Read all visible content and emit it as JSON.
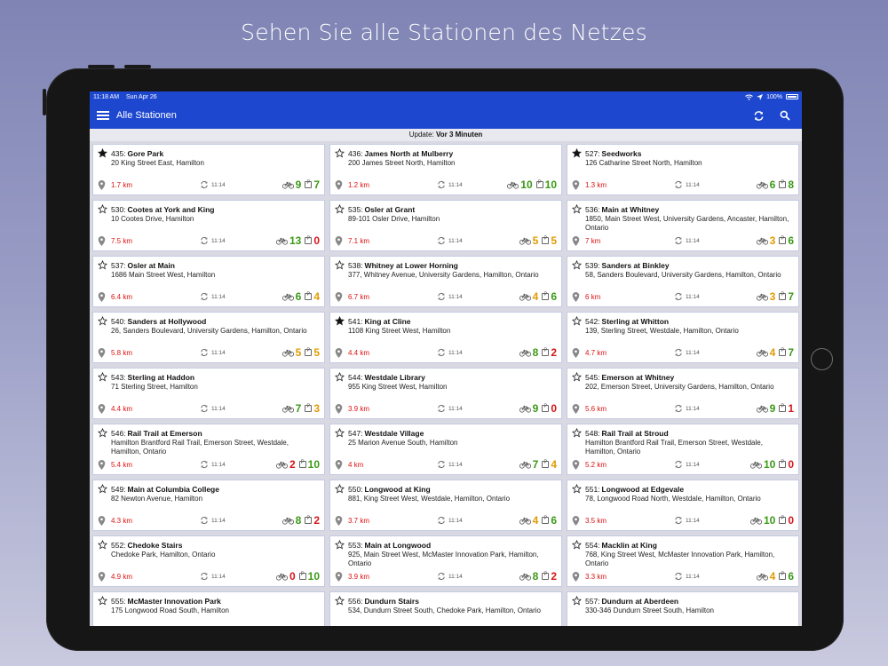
{
  "headline": "Sehen Sie alle Stationen des Netzes",
  "status_bar": {
    "time": "11:18 AM",
    "date": "Sun Apr 26",
    "battery": "100%"
  },
  "app_bar": {
    "title": "Alle Stationen",
    "menu_icon": "hamburger-menu-icon",
    "refresh_icon": "refresh-icon",
    "search_icon": "search-icon"
  },
  "update": {
    "label": "Update:",
    "value": "Vor 3 Minuten"
  },
  "colors": {
    "app_bar": "#1d47cf",
    "distance": "#dd1111",
    "good": "#3a9a16",
    "medium": "#e19a00",
    "bad": "#d6151a"
  },
  "stations": [
    {
      "id": "435:",
      "name": "Gore Park",
      "address": "20 King Street East, Hamilton",
      "distance": "1.7 km",
      "updated": "11:14",
      "bikes": "9",
      "bikes_level": "g",
      "docks": "7",
      "docks_level": "g",
      "favorite": true
    },
    {
      "id": "436:",
      "name": "James North at Mulberry",
      "address": "200 James Street North, Hamilton",
      "distance": "1.2 km",
      "updated": "11:14",
      "bikes": "10",
      "bikes_level": "g",
      "docks": "10",
      "docks_level": "g",
      "favorite": false
    },
    {
      "id": "527:",
      "name": "Seedworks",
      "address": "126 Catharine Street North, Hamilton",
      "distance": "1.3 km",
      "updated": "11:14",
      "bikes": "6",
      "bikes_level": "g",
      "docks": "8",
      "docks_level": "g",
      "favorite": true
    },
    {
      "id": "530:",
      "name": "Cootes at York and King",
      "address": "10 Cootes Drive, Hamilton",
      "distance": "7.5 km",
      "updated": "11:14",
      "bikes": "13",
      "bikes_level": "g",
      "docks": "0",
      "docks_level": "r",
      "favorite": false
    },
    {
      "id": "535:",
      "name": "Osler at Grant",
      "address": "89-101 Osler Drive, Hamilton",
      "distance": "7.1 km",
      "updated": "11:14",
      "bikes": "5",
      "bikes_level": "o",
      "docks": "5",
      "docks_level": "o",
      "favorite": false
    },
    {
      "id": "536:",
      "name": "Main at Whitney",
      "address": "1850, Main Street West, University Gardens, Ancaster, Hamilton, Ontario",
      "distance": "7 km",
      "updated": "11:14",
      "bikes": "3",
      "bikes_level": "o",
      "docks": "6",
      "docks_level": "g",
      "favorite": false
    },
    {
      "id": "537:",
      "name": "Osler at Main",
      "address": "1686 Main Street West, Hamilton",
      "distance": "6.4 km",
      "updated": "11:14",
      "bikes": "6",
      "bikes_level": "g",
      "docks": "4",
      "docks_level": "o",
      "favorite": false
    },
    {
      "id": "538:",
      "name": "Whitney at Lower Horning",
      "address": "377, Whitney Avenue, University Gardens, Hamilton, Ontario",
      "distance": "6.7 km",
      "updated": "11:14",
      "bikes": "4",
      "bikes_level": "o",
      "docks": "6",
      "docks_level": "g",
      "favorite": false
    },
    {
      "id": "539:",
      "name": "Sanders at Binkley",
      "address": "58, Sanders Boulevard, University Gardens, Hamilton, Ontario",
      "distance": "6 km",
      "updated": "11:14",
      "bikes": "3",
      "bikes_level": "o",
      "docks": "7",
      "docks_level": "g",
      "favorite": false
    },
    {
      "id": "540:",
      "name": "Sanders at Hollywood",
      "address": "26, Sanders Boulevard, University Gardens, Hamilton, Ontario",
      "distance": "5.8 km",
      "updated": "11:14",
      "bikes": "5",
      "bikes_level": "o",
      "docks": "5",
      "docks_level": "o",
      "favorite": false
    },
    {
      "id": "541:",
      "name": "King at Cline",
      "address": "1108 King Street West, Hamilton",
      "distance": "4.4 km",
      "updated": "11:14",
      "bikes": "8",
      "bikes_level": "g",
      "docks": "2",
      "docks_level": "r",
      "favorite": true
    },
    {
      "id": "542:",
      "name": "Sterling at Whitton",
      "address": "139, Sterling Street, Westdale, Hamilton, Ontario",
      "distance": "4.7 km",
      "updated": "11:14",
      "bikes": "4",
      "bikes_level": "o",
      "docks": "7",
      "docks_level": "g",
      "favorite": false
    },
    {
      "id": "543:",
      "name": "Sterling at Haddon",
      "address": "71 Sterling Street, Hamilton",
      "distance": "4.4 km",
      "updated": "11:14",
      "bikes": "7",
      "bikes_level": "g",
      "docks": "3",
      "docks_level": "o",
      "favorite": false
    },
    {
      "id": "544:",
      "name": "Westdale Library",
      "address": "955 King Street West, Hamilton",
      "distance": "3.9 km",
      "updated": "11:14",
      "bikes": "9",
      "bikes_level": "g",
      "docks": "0",
      "docks_level": "r",
      "favorite": false
    },
    {
      "id": "545:",
      "name": "Emerson at Whitney",
      "address": "202, Emerson Street, University Gardens, Hamilton, Ontario",
      "distance": "5.6 km",
      "updated": "11:14",
      "bikes": "9",
      "bikes_level": "g",
      "docks": "1",
      "docks_level": "r",
      "favorite": false
    },
    {
      "id": "546:",
      "name": "Rail Trail at Emerson",
      "address": "Hamilton Brantford Rail Trail, Emerson Street, Westdale, Hamilton, Ontario",
      "distance": "5.4 km",
      "updated": "11:14",
      "bikes": "2",
      "bikes_level": "r",
      "docks": "10",
      "docks_level": "g",
      "favorite": false
    },
    {
      "id": "547:",
      "name": "Westdale Village",
      "address": "25 Marion Avenue South, Hamilton",
      "distance": "4 km",
      "updated": "11:14",
      "bikes": "7",
      "bikes_level": "g",
      "docks": "4",
      "docks_level": "o",
      "favorite": false
    },
    {
      "id": "548:",
      "name": "Rail Trail at Stroud",
      "address": "Hamilton Brantford Rail Trail, Emerson Street, Westdale, Hamilton, Ontario",
      "distance": "5.2 km",
      "updated": "11:14",
      "bikes": "10",
      "bikes_level": "g",
      "docks": "0",
      "docks_level": "r",
      "favorite": false
    },
    {
      "id": "549:",
      "name": "Main at Columbia College",
      "address": "82 Newton Avenue, Hamilton",
      "distance": "4.3 km",
      "updated": "11:14",
      "bikes": "8",
      "bikes_level": "g",
      "docks": "2",
      "docks_level": "r",
      "favorite": false
    },
    {
      "id": "550:",
      "name": "Longwood at King",
      "address": "881, King Street West, Westdale, Hamilton, Ontario",
      "distance": "3.7 km",
      "updated": "11:14",
      "bikes": "4",
      "bikes_level": "o",
      "docks": "6",
      "docks_level": "g",
      "favorite": false
    },
    {
      "id": "551:",
      "name": "Longwood at Edgevale",
      "address": "78, Longwood Road North, Westdale, Hamilton, Ontario",
      "distance": "3.5 km",
      "updated": "11:14",
      "bikes": "10",
      "bikes_level": "g",
      "docks": "0",
      "docks_level": "r",
      "favorite": false
    },
    {
      "id": "552:",
      "name": "Chedoke Stairs",
      "address": "Chedoke Park, Hamilton, Ontario",
      "distance": "4.9 km",
      "updated": "11:14",
      "bikes": "0",
      "bikes_level": "r",
      "docks": "10",
      "docks_level": "g",
      "favorite": false
    },
    {
      "id": "553:",
      "name": "Main at Longwood",
      "address": "925, Main Street West, McMaster Innovation Park, Hamilton, Ontario",
      "distance": "3.9 km",
      "updated": "11:14",
      "bikes": "8",
      "bikes_level": "g",
      "docks": "2",
      "docks_level": "r",
      "favorite": false
    },
    {
      "id": "554:",
      "name": "Macklin at King",
      "address": "768, King Street West, McMaster Innovation Park, Hamilton, Ontario",
      "distance": "3.3 km",
      "updated": "11:14",
      "bikes": "4",
      "bikes_level": "o",
      "docks": "6",
      "docks_level": "g",
      "favorite": false
    },
    {
      "id": "555:",
      "name": "McMaster Innovation Park",
      "address": "175 Longwood Road South, Hamilton",
      "distance": "",
      "updated": "",
      "bikes": "",
      "bikes_level": "g",
      "docks": "",
      "docks_level": "g",
      "favorite": false,
      "cut_off": true
    },
    {
      "id": "556:",
      "name": "Dundurn Stairs",
      "address": "534, Dundurn Street South, Chedoke Park, Hamilton, Ontario",
      "distance": "",
      "updated": "",
      "bikes": "",
      "bikes_level": "g",
      "docks": "",
      "docks_level": "g",
      "favorite": false,
      "cut_off": true
    },
    {
      "id": "557:",
      "name": "Dundurn at Aberdeen",
      "address": "330-346 Dundurn Street South, Hamilton",
      "distance": "",
      "updated": "",
      "bikes": "",
      "bikes_level": "g",
      "docks": "",
      "docks_level": "g",
      "favorite": false,
      "cut_off": true
    }
  ]
}
